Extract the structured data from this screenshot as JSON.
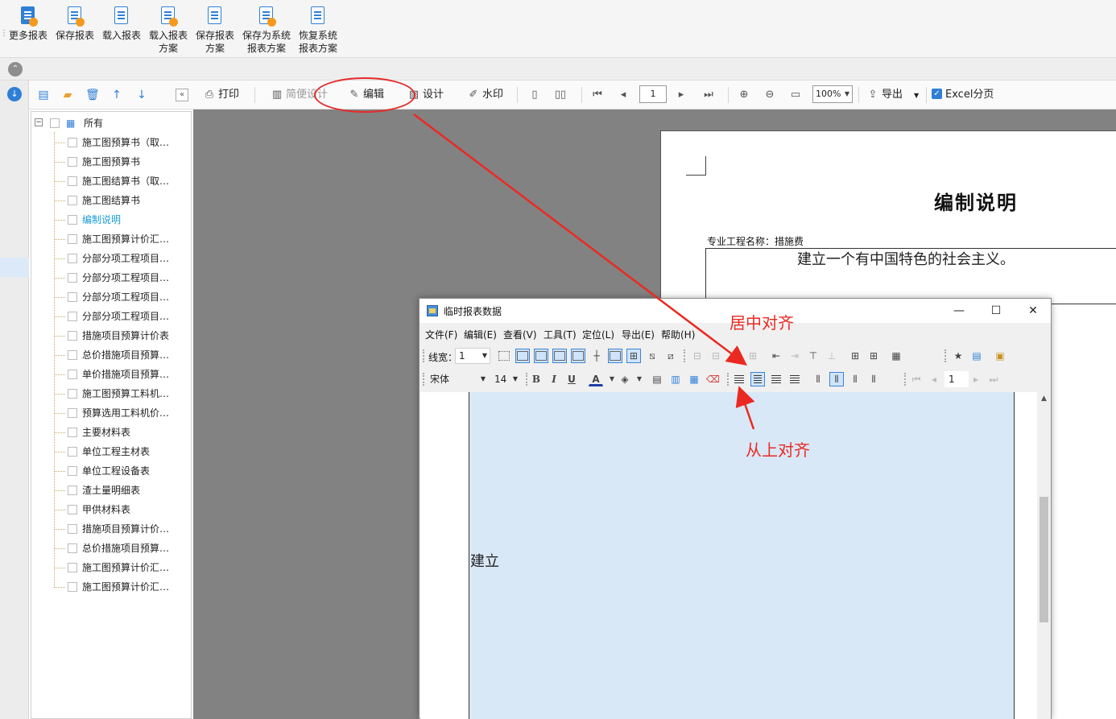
{
  "ribbon": {
    "buttons": [
      {
        "label1": "更多报表",
        "label2": ""
      },
      {
        "label1": "保存报表",
        "label2": ""
      },
      {
        "label1": "载入报表",
        "label2": ""
      },
      {
        "label1": "载入报表",
        "label2": "方案"
      },
      {
        "label1": "保存报表",
        "label2": "方案"
      },
      {
        "label1": "保存为系统",
        "label2": "报表方案"
      },
      {
        "label1": "恢复系统",
        "label2": "报表方案"
      }
    ]
  },
  "tree": {
    "root_label": "所有",
    "items": [
      "施工图预算书（取…",
      "施工图预算书",
      "施工图结算书（取…",
      "施工图结算书",
      "编制说明",
      "施工图预算计价汇…",
      "分部分项工程项目…",
      "分部分项工程项目…",
      "分部分项工程项目…",
      "分部分项工程项目…",
      "措施项目预算计价表",
      "总价措施项目预算…",
      "单价措施项目预算…",
      "施工图预算工料机…",
      "预算选用工料机价…",
      "主要材料表",
      "单位工程主材表",
      "单位工程设备表",
      "渣土量明细表",
      "甲供材料表",
      "措施项目预算计价…",
      "总价措施项目预算…",
      "施工图预算计价汇…",
      "施工图预算计价汇…"
    ],
    "active_index": 4
  },
  "toolbar": {
    "print": "打印",
    "simple_design": "简便设计",
    "edit": "编辑",
    "design": "设计",
    "watermark": "水印",
    "page": "1",
    "zoom": "100%",
    "export": "导出",
    "excel_paging": "Excel分页"
  },
  "report": {
    "title": "编制说明",
    "project_label": "专业工程名称：措施费",
    "content": "建立一个有中国特色的社会主义。"
  },
  "dialog": {
    "title": "临时报表数据",
    "menu": [
      "文件(F)",
      "编辑(E)",
      "查看(V)",
      "工具(T)",
      "定位(L)",
      "导出(E)",
      "帮助(H)"
    ],
    "line_width_label": "线宽：",
    "line_width_value": "1",
    "font_name": "宋体",
    "font_size": "14",
    "page_value": "1",
    "cell_text": "建立"
  },
  "annotations": {
    "center_align": "居中对齐",
    "top_align": "从上对齐"
  },
  "colors": {
    "accent": "#2f7fd6",
    "annotation": "#ea2a22",
    "preview_bg": "#828282",
    "cell_selected": "#d9e8f7",
    "active_tree_item": "#1a9cd6"
  }
}
